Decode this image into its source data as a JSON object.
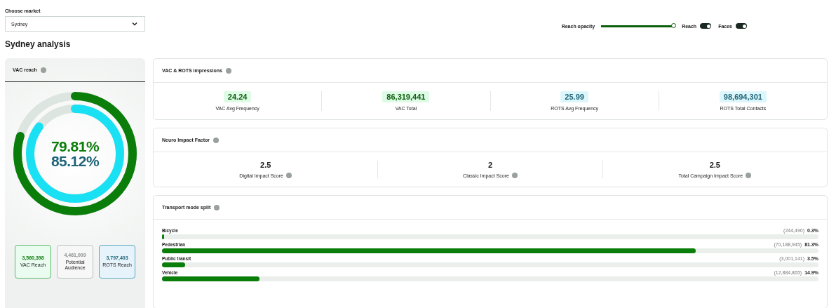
{
  "market": {
    "label": "Choose market",
    "value": "Sydney"
  },
  "controls": {
    "opacity_label": "Reach opacity",
    "opacity": {
      "level": 1
    },
    "toggles": [
      {
        "label": "Reach",
        "on": true
      },
      {
        "label": "Faces",
        "on": true
      }
    ]
  },
  "heading": "Sydney analysis",
  "vac_reach": {
    "title": "VAC reach",
    "outer": {
      "level": 0.7981,
      "text": "79.81%"
    },
    "inner": {
      "level": 0.8512,
      "text": "85.12%"
    },
    "stats": [
      {
        "kind": "vac",
        "value": "3,560,398",
        "label": "VAC Reach"
      },
      {
        "kind": "potential",
        "value": "4,461,009",
        "label": "Potential Audience"
      },
      {
        "kind": "rots",
        "value": "3,797,403",
        "label": "ROTS Reach"
      }
    ]
  },
  "impressions": {
    "title": "VAC & ROTS impressions",
    "items": [
      {
        "kind": "vac",
        "value": "24.24",
        "label": "VAC Avg Frequency"
      },
      {
        "kind": "vac",
        "value": "86,319,441",
        "label": "VAC Total"
      },
      {
        "kind": "rots",
        "value": "25.99",
        "label": "ROTS Avg Frequency"
      },
      {
        "kind": "rots",
        "value": "98,694,301",
        "label": "ROTS Total Contacts"
      }
    ]
  },
  "neuro": {
    "title": "Neuro Impact Factor",
    "items": [
      {
        "value": "2.5",
        "label": "Digital Impact Score"
      },
      {
        "value": "2",
        "label": "Classic Impact Score"
      },
      {
        "value": "2.5",
        "label": "Total Campaign Impact Score"
      }
    ]
  },
  "transport": {
    "title": "Transport mode split",
    "modes": [
      {
        "name": "Bicycle",
        "count": "(244,490)",
        "share": "0.3%",
        "level": 0.003
      },
      {
        "name": "Pedestrian",
        "count": "(70,188,945)",
        "share": "81.3%",
        "level": 0.813
      },
      {
        "name": "Public transit",
        "count": "(3,001,141)",
        "share": "3.5%",
        "level": 0.035
      },
      {
        "name": "Vehicle",
        "count": "(12,884,865)",
        "share": "14.9%",
        "level": 0.149
      }
    ]
  }
}
